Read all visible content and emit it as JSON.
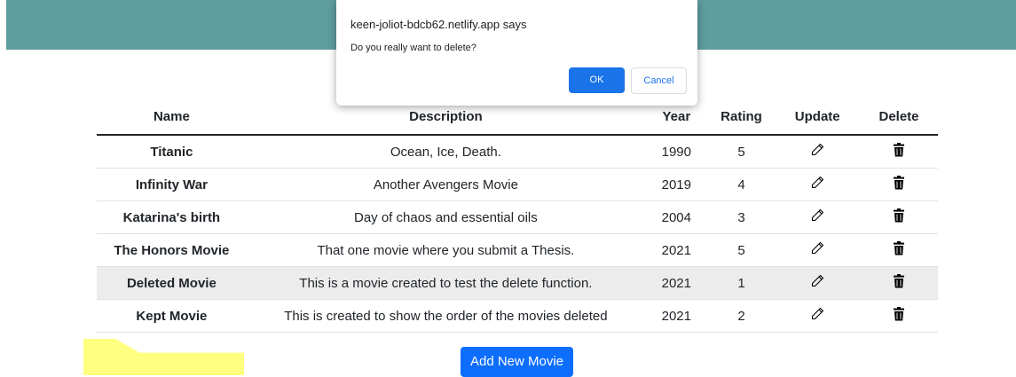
{
  "table": {
    "headers": [
      "Name",
      "Description",
      "Year",
      "Rating",
      "Update",
      "Delete"
    ],
    "rows": [
      {
        "name": "Titanic",
        "description": "Ocean, Ice, Death.",
        "year": "1990",
        "rating": "5"
      },
      {
        "name": "Infinity War",
        "description": "Another Avengers Movie",
        "year": "2019",
        "rating": "4"
      },
      {
        "name": "Katarina's birth",
        "description": "Day of chaos and essential oils",
        "year": "2004",
        "rating": "3"
      },
      {
        "name": "The Honors Movie",
        "description": "That one movie where you submit a Thesis.",
        "year": "2021",
        "rating": "5"
      },
      {
        "name": "Deleted Movie",
        "description": "This is a movie created to test the delete function.",
        "year": "2021",
        "rating": "1"
      },
      {
        "name": "Kept Movie",
        "description": "This is created to show the order of the movies deleted",
        "year": "2021",
        "rating": "2"
      }
    ],
    "update_icon": "pencil-icon",
    "delete_icon": "trash-icon",
    "hovered_row": "Deleted Movie"
  },
  "add_button": {
    "label": "Add New Movie"
  },
  "dialog": {
    "title": "keen-joliot-bdcb62.netlify.app says",
    "message": "Do you really want to delete?",
    "ok_label": "OK",
    "cancel_label": "Cancel"
  },
  "colors": {
    "header_bar": "#5f9ea0",
    "primary_button": "#0d6efd",
    "dialog_ok": "#1a73e8",
    "highlight": "#ffff80"
  }
}
